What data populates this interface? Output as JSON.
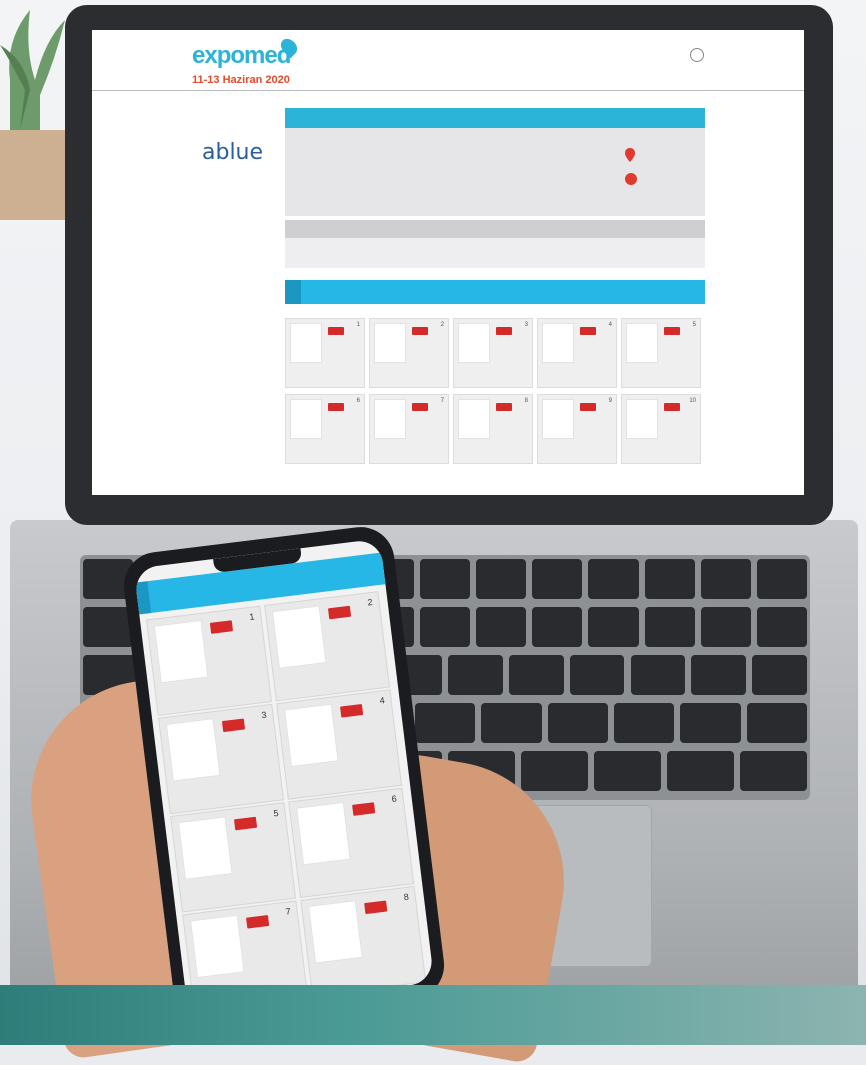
{
  "site": {
    "logo": "expomed",
    "dates": "11-13 Haziran 2020",
    "nav": [
      "",
      "",
      "",
      "",
      "",
      ""
    ],
    "brand": "ablue",
    "brand_sub": "",
    "sidebar_link": "",
    "info_headers": [
      "",
      "",
      ""
    ],
    "info_lines": [
      "",
      "",
      "",
      ""
    ],
    "categories_title": "",
    "categories_text": "",
    "tabs": [
      "",
      "",
      ""
    ],
    "products": [
      {
        "num": "1",
        "label": ""
      },
      {
        "num": "2",
        "label": ""
      },
      {
        "num": "3",
        "label": ""
      },
      {
        "num": "4",
        "label": ""
      },
      {
        "num": "5",
        "label": ""
      },
      {
        "num": "6",
        "label": ""
      },
      {
        "num": "7",
        "label": ""
      },
      {
        "num": "8",
        "label": ""
      },
      {
        "num": "9",
        "label": ""
      },
      {
        "num": "10",
        "label": ""
      }
    ]
  },
  "phone": {
    "tabs": [
      "",
      "",
      ""
    ],
    "cards": [
      {
        "num": "1",
        "label": ""
      },
      {
        "num": "2",
        "label": ""
      },
      {
        "num": "3",
        "label": ""
      },
      {
        "num": "4",
        "label": ""
      },
      {
        "num": "5",
        "label": ""
      },
      {
        "num": "6",
        "label": ""
      },
      {
        "num": "7",
        "label": ""
      },
      {
        "num": "8",
        "label": ""
      }
    ]
  },
  "colors": {
    "accent": "#27b7e6",
    "brand_blue": "#2a5e9c",
    "flag_red": "#d42a2a",
    "date_red": "#e54b2a"
  }
}
